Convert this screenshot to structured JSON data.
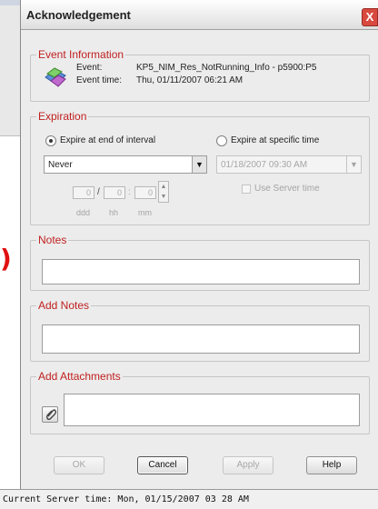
{
  "background": {
    "paren_fragment": ")"
  },
  "dialog": {
    "title": "Acknowledgement",
    "close_glyph": "X"
  },
  "event_info": {
    "legend": "Event Information",
    "event_label": "Event:",
    "event_value": "KP5_NIM_Res_NotRunning_Info - p5900:P5",
    "time_label": "Event time:",
    "time_value": "Thu, 01/11/2007 06:21 AM",
    "icon": "event-icon"
  },
  "expiration": {
    "legend": "Expiration",
    "option_interval": "Expire at end of interval",
    "option_specific": "Expire at specific time",
    "selected_option": "interval",
    "interval_select_value": "Never",
    "datetime_value": "01/18/2007 09:30 AM",
    "use_server_time": "Use Server time",
    "spin_ddd": "0",
    "spin_hh": "0",
    "spin_mm": "0",
    "sep_slash": "/",
    "sep_colon": ":",
    "unit_ddd": "ddd",
    "unit_hh": "hh",
    "unit_mm": "mm"
  },
  "notes": {
    "legend": "Notes"
  },
  "add_notes": {
    "legend": "Add Notes"
  },
  "attachments": {
    "legend": "Add Attachments",
    "icon": "paperclip-icon"
  },
  "buttons": {
    "ok": "OK",
    "cancel": "Cancel",
    "apply": "Apply",
    "help": "Help"
  },
  "status_bar": {
    "text": "Current Server time: Mon, 01/15/2007 03 28 AM"
  },
  "colors": {
    "legend": "#c02020",
    "close": "#d84a3f"
  }
}
